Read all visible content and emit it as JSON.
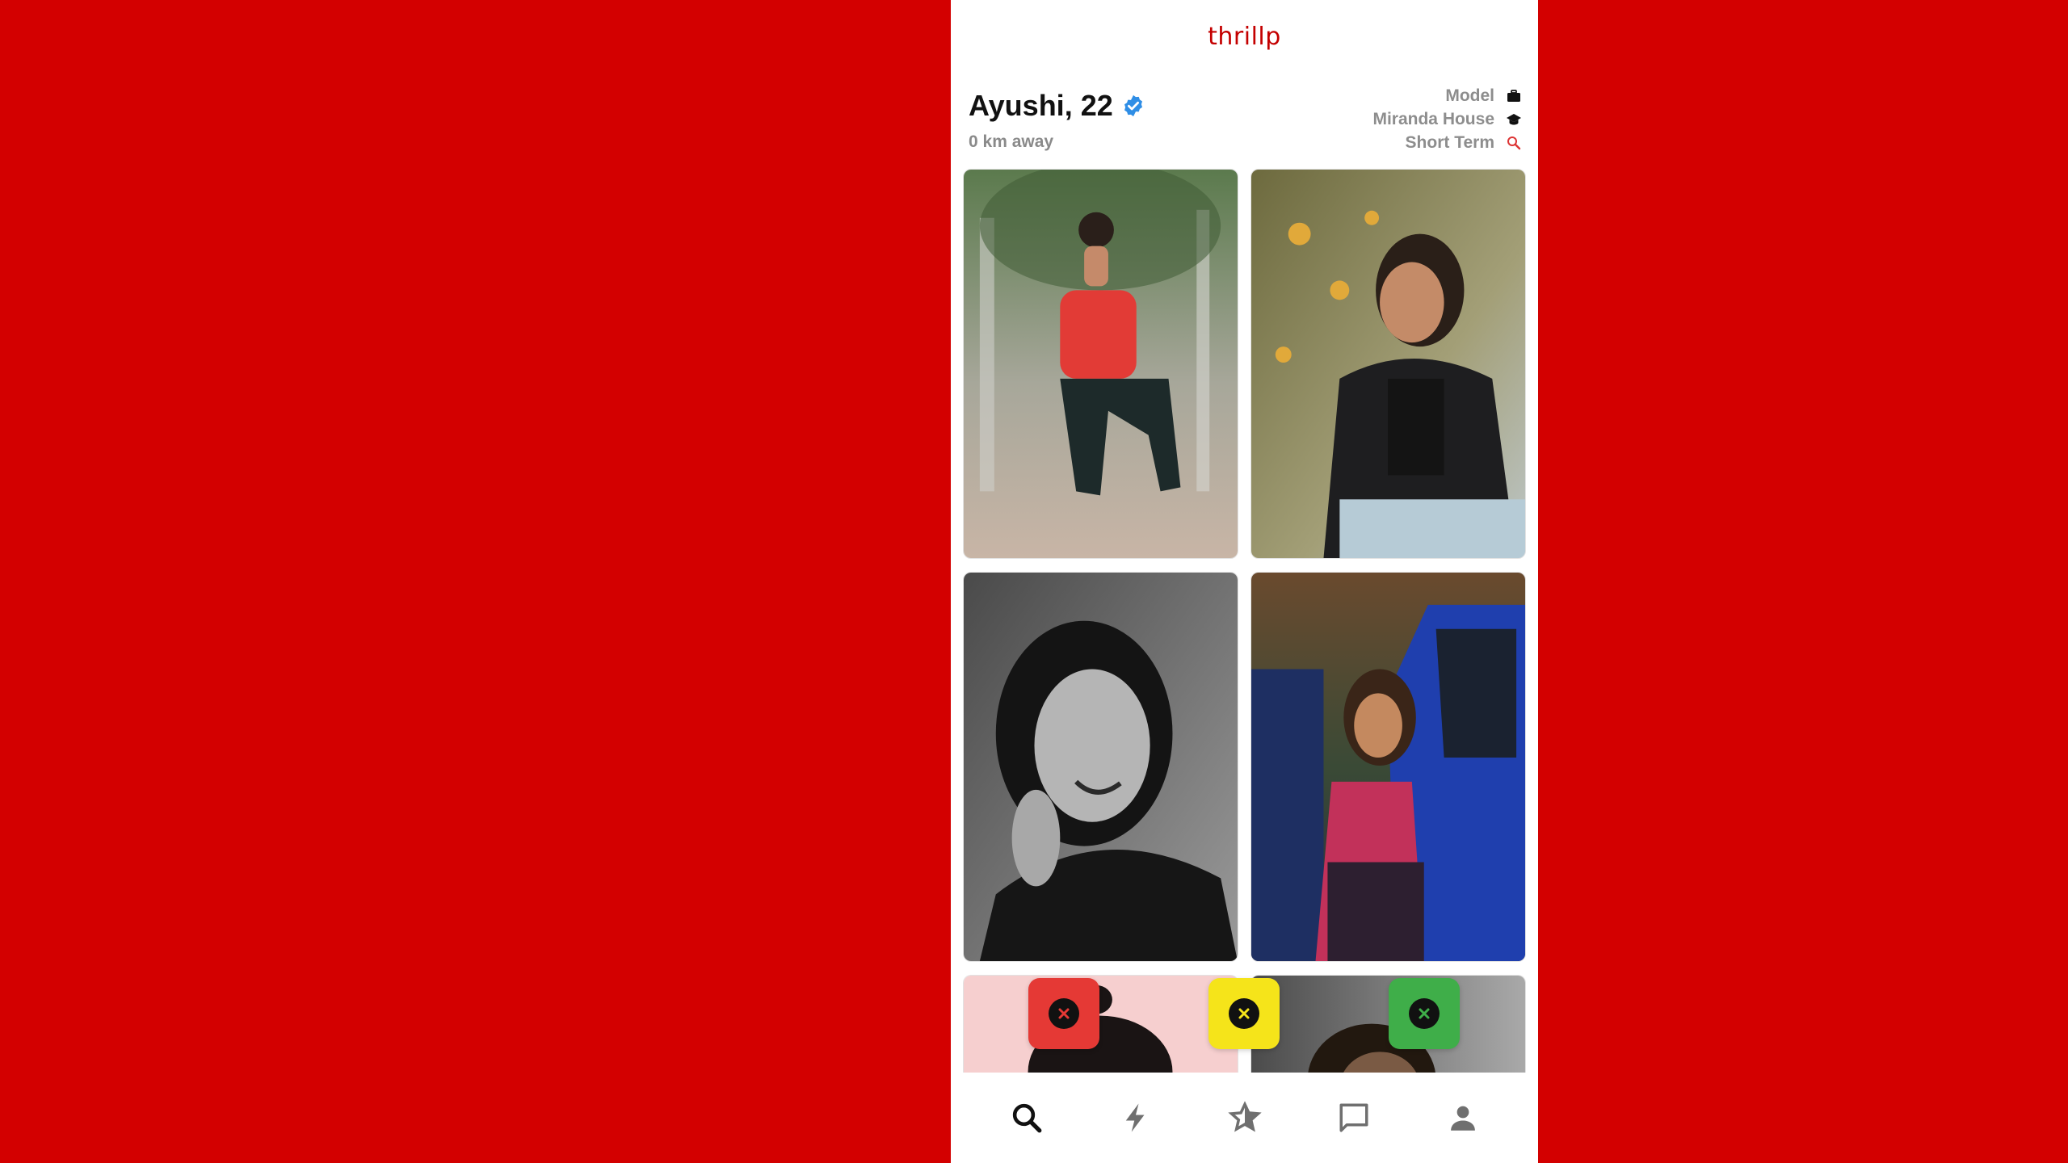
{
  "app": {
    "brand": "thrillp"
  },
  "profile": {
    "name_age": "Ayushi, 22",
    "distance": "0 km away",
    "verified_icon": "verified-badge-icon",
    "tags": [
      {
        "label": "Model",
        "icon": "briefcase-icon"
      },
      {
        "label": "Miranda House",
        "icon": "graduation-cap-icon"
      },
      {
        "label": "Short Term",
        "icon": "search-icon"
      }
    ]
  },
  "photos": [
    {
      "subject": "woman-red-top-squatting"
    },
    {
      "subject": "woman-leather-jacket-flowers"
    },
    {
      "subject": "woman-black-and-white-portrait"
    },
    {
      "subject": "woman-by-blue-car"
    },
    {
      "subject": "woman-pink-background"
    },
    {
      "subject": "woman-outdoor-portrait"
    }
  ],
  "actions": [
    {
      "name": "reject-red",
      "color": "#e53935",
      "icon": "close-circle-icon"
    },
    {
      "name": "reject-yellow",
      "color": "#f5e41a",
      "icon": "close-circle-icon"
    },
    {
      "name": "reject-green",
      "color": "#3fae49",
      "icon": "close-circle-icon"
    }
  ],
  "nav": [
    {
      "name": "search",
      "icon": "search-icon",
      "active": true
    },
    {
      "name": "boost",
      "icon": "lightning-icon",
      "active": false
    },
    {
      "name": "favorites",
      "icon": "star-icon",
      "active": false
    },
    {
      "name": "messages",
      "icon": "chat-icon",
      "active": false
    },
    {
      "name": "profile",
      "icon": "person-icon",
      "active": false
    }
  ],
  "colors": {
    "background": "#d30000",
    "brand": "#c40000",
    "verified": "#2f8ee6",
    "muted_text": "#8d8d8d"
  }
}
